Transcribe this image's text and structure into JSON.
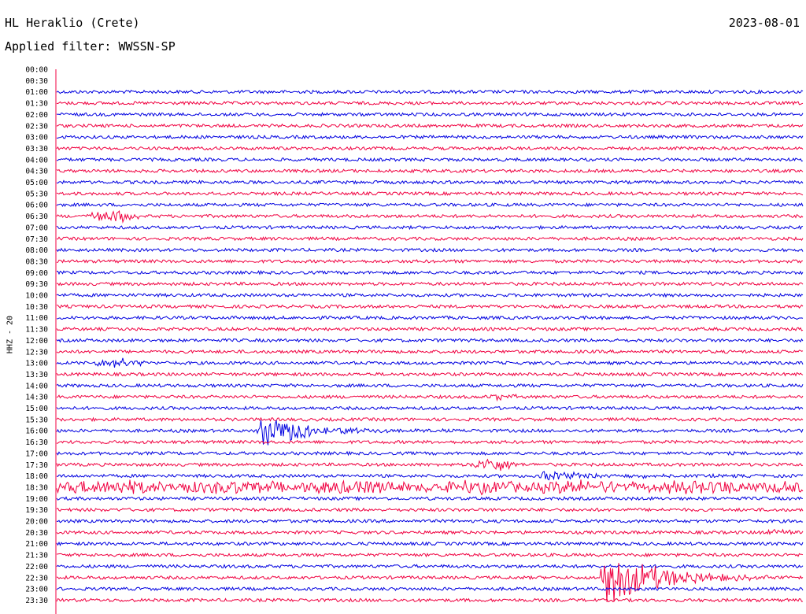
{
  "header": {
    "station": "HL Heraklio (Crete)",
    "date": "2023-08-01",
    "filter": "Applied filter: WWSSN-SP"
  },
  "channel_label": "HHZ - 20",
  "colors": {
    "blue": "#0000e0",
    "red": "#f00040"
  },
  "chart_data": {
    "type": "line",
    "title": "HL Heraklio (Crete)",
    "subtitle": "Applied filter: WWSSN-SP",
    "ylabel": "HHZ - 20",
    "grid": false,
    "x_unit": "minutes within trace (0-30)",
    "tick_labels": [
      "00:00",
      "00:30",
      "01:00",
      "01:30",
      "02:00",
      "02:30",
      "03:00",
      "03:30",
      "04:00",
      "04:30",
      "05:00",
      "05:30",
      "06:00",
      "06:30",
      "07:00",
      "07:30",
      "08:00",
      "08:30",
      "09:00",
      "09:30",
      "10:00",
      "10:30",
      "11:00",
      "11:30",
      "12:00",
      "12:30",
      "13:00",
      "13:30",
      "14:00",
      "14:30",
      "15:00",
      "15:30",
      "16:00",
      "16:30",
      "17:00",
      "17:30",
      "18:00",
      "18:30",
      "19:00",
      "19:30",
      "20:00",
      "20:30",
      "21:00",
      "21:30",
      "22:00",
      "22:30",
      "23:00",
      "23:30"
    ],
    "trace_colors_cycle": [
      "blue",
      "red"
    ],
    "noise_level": 2,
    "events": [
      {
        "trace": "06:30",
        "start_min": 1.0,
        "duration_min": 2.5,
        "amplitude": 7,
        "shape": "burst"
      },
      {
        "trace": "13:00",
        "start_min": 1.3,
        "duration_min": 2.5,
        "amplitude": 5,
        "shape": "burst"
      },
      {
        "trace": "14:30",
        "start_min": 17.2,
        "duration_min": 1.5,
        "amplitude": 3,
        "shape": "burst"
      },
      {
        "trace": "16:00",
        "start_min": 8.0,
        "duration_min": 8.5,
        "amplitude": 20,
        "shape": "quake"
      },
      {
        "trace": "17:30",
        "start_min": 16.6,
        "duration_min": 2.0,
        "amplitude": 8,
        "shape": "burst"
      },
      {
        "trace": "18:00",
        "start_min": 19.3,
        "duration_min": 10.7,
        "amplitude": 6,
        "shape": "quake"
      },
      {
        "trace": "18:30",
        "start_min": 0.0,
        "duration_min": 30.0,
        "amplitude": 8,
        "shape": "wave"
      },
      {
        "trace": "20:30",
        "start_min": 28.0,
        "duration_min": 2.0,
        "amplitude": 3,
        "shape": "burst"
      },
      {
        "trace": "22:30",
        "start_min": 21.8,
        "duration_min": 8.2,
        "amplitude": 38,
        "shape": "quake"
      }
    ]
  }
}
